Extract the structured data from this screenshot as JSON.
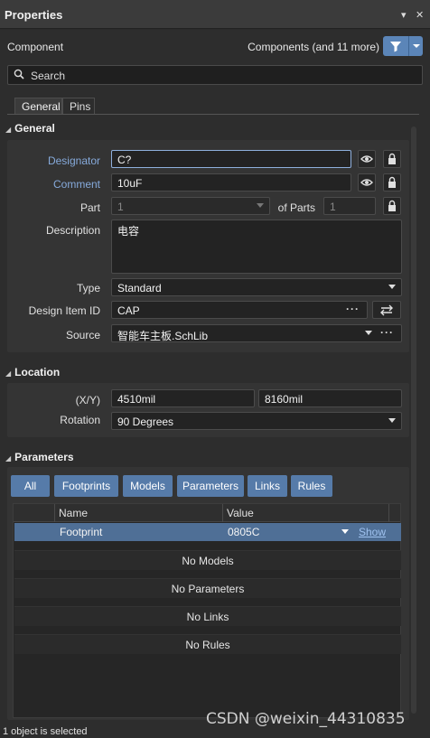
{
  "window": {
    "title": "Properties"
  },
  "header": {
    "left_label": "Component",
    "right_label": "Components (and 11 more)"
  },
  "search": {
    "placeholder": "Search"
  },
  "tabs": [
    {
      "label": "General"
    },
    {
      "label": "Pins"
    }
  ],
  "general": {
    "heading": "General",
    "designator": {
      "label": "Designator",
      "value": "C?"
    },
    "comment": {
      "label": "Comment",
      "value": "10uF"
    },
    "part": {
      "label": "Part",
      "value": "1",
      "of_parts_label": "of Parts",
      "of_parts_value": "1"
    },
    "description": {
      "label": "Description",
      "value": "电容"
    },
    "type": {
      "label": "Type",
      "value": "Standard"
    },
    "design_item_id": {
      "label": "Design Item ID",
      "value": "CAP"
    },
    "source": {
      "label": "Source",
      "value": "智能车主板.SchLib"
    }
  },
  "location": {
    "heading": "Location",
    "xy": {
      "label": "(X/Y)",
      "x": "4510mil",
      "y": "8160mil"
    },
    "rotation": {
      "label": "Rotation",
      "value": "90 Degrees"
    }
  },
  "parameters": {
    "heading": "Parameters",
    "filters": [
      {
        "label": "All"
      },
      {
        "label": "Footprints"
      },
      {
        "label": "Models"
      },
      {
        "label": "Parameters"
      },
      {
        "label": "Links"
      },
      {
        "label": "Rules"
      }
    ],
    "columns": [
      "Name",
      "Value"
    ],
    "rows": [
      {
        "name": "Footprint",
        "value": "0805C",
        "action": "Show"
      }
    ],
    "messages": [
      "No Models",
      "No Parameters",
      "No Links",
      "No Rules"
    ]
  },
  "status": {
    "text": "1 object is selected"
  },
  "watermark": "CSDN @weixin_44310835",
  "colors": {
    "accent": "#567ba9",
    "background": "#2d2d2d",
    "label_blue": "#86aadb"
  },
  "icons": [
    "menu-dropdown-icon",
    "close-icon",
    "filter-icon",
    "search-icon",
    "eye-icon",
    "lock-icon",
    "swap-icon"
  ]
}
